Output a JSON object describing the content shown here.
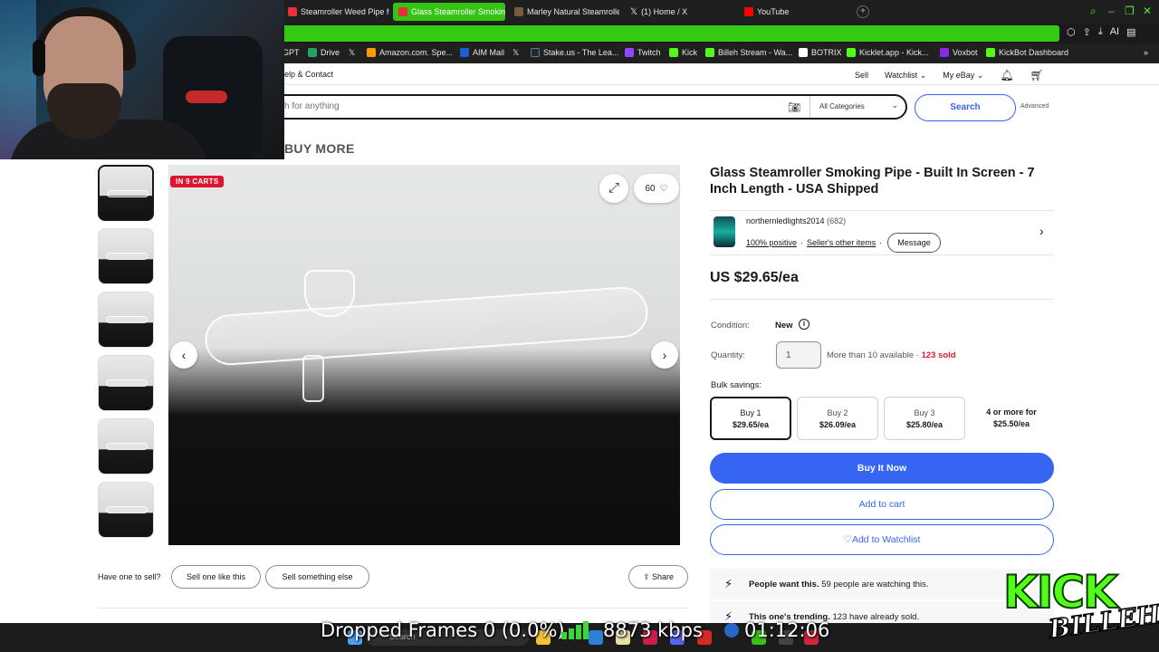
{
  "browser": {
    "tabs": [
      {
        "label": "Steamroller Weed Pipe for",
        "active": false,
        "favicon_color": "#e53238"
      },
      {
        "label": "Glass Steamroller Smokin",
        "active": true,
        "favicon_color": "#e53238"
      },
      {
        "label": "Marley Natural Steamroller",
        "active": false,
        "favicon_color": "#7a5b3a"
      },
      {
        "label": "(1) Home / X",
        "active": false,
        "favicon_color": "#ffffff"
      },
      {
        "label": "YouTube",
        "active": false,
        "favicon_color": "#ff0000"
      }
    ],
    "new_tab": "+",
    "toolbar_ai": "AI",
    "bookmarks": [
      {
        "label": "GPT",
        "color": "#10a37f"
      },
      {
        "label": "Drive",
        "color": "#1fa463"
      },
      {
        "label": "",
        "color": "#ffffff"
      },
      {
        "label": "Amazon.com. Spe...",
        "color": "#ff9900"
      },
      {
        "label": "AIM Mail",
        "color": "#1b5fd6"
      },
      {
        "label": "",
        "color": "#ffffff"
      },
      {
        "label": "Stake.us - The Lea...",
        "color": "#1a2c38"
      },
      {
        "label": "Twitch",
        "color": "#9146ff"
      },
      {
        "label": "Kick",
        "color": "#53fc18"
      },
      {
        "label": "Billeh Stream - Wa...",
        "color": "#53fc18"
      },
      {
        "label": "BOTRIX",
        "color": "#ffffff"
      },
      {
        "label": "Kicklet.app - Kick...",
        "color": "#53fc18"
      },
      {
        "label": "Voxbot",
        "color": "#8a2be2"
      },
      {
        "label": "KickBot Dashboard",
        "color": "#53fc18"
      }
    ]
  },
  "ebay": {
    "topnav": {
      "help": "elp & Contact",
      "sell": "Sell",
      "watchlist": "Watchlist",
      "myebay": "My eBay"
    },
    "search": {
      "placeholder": "h for anything",
      "category": "All Categories",
      "button": "Search",
      "advanced": "Advanced"
    },
    "buy_more": "BUY MORE",
    "badge": "IN 9 CARTS",
    "watch_count": "60",
    "product": {
      "title": "Glass Steamroller Smoking Pipe - Built In Screen - 7 Inch Length - USA Shipped",
      "seller_name": "northernledlights2014",
      "seller_count": "(682)",
      "positive": "100% positive",
      "other_items": "Seller's other items",
      "message": "Message",
      "price": "US $29.65/ea",
      "condition_label": "Condition:",
      "condition": "New",
      "quantity_label": "Quantity:",
      "quantity": "1",
      "available": "More than 10 available",
      "sold": "123 sold",
      "bulk_label": "Bulk savings:",
      "bulk": [
        {
          "label": "Buy 1",
          "price": "$29.65/ea"
        },
        {
          "label": "Buy 2",
          "price": "$26.09/ea"
        },
        {
          "label": "Buy 3",
          "price": "$25.80/ea"
        },
        {
          "label": "4 or more for",
          "price": "$25.50/ea"
        }
      ],
      "buy_now": "Buy It Now",
      "add_cart": "Add to cart",
      "add_watch": "Add to Watchlist"
    },
    "promos": [
      {
        "title": "People want this.",
        "text": "59 people are watching this."
      },
      {
        "title": "This one's trending.",
        "text": "123 have already sold."
      }
    ],
    "sell_row": {
      "label": "Have one to sell?",
      "sell_like": "Sell one like this",
      "sell_else": "Sell something else",
      "share": "Share"
    }
  },
  "overlay": {
    "dropped_frames": "Dropped Frames 0 (0.0%)",
    "bitrate": "8873 kbps",
    "uptime": "01:12:06",
    "taskbar_search": "Search",
    "kick_logo": "KICK",
    "streamer": "BILLEH"
  }
}
